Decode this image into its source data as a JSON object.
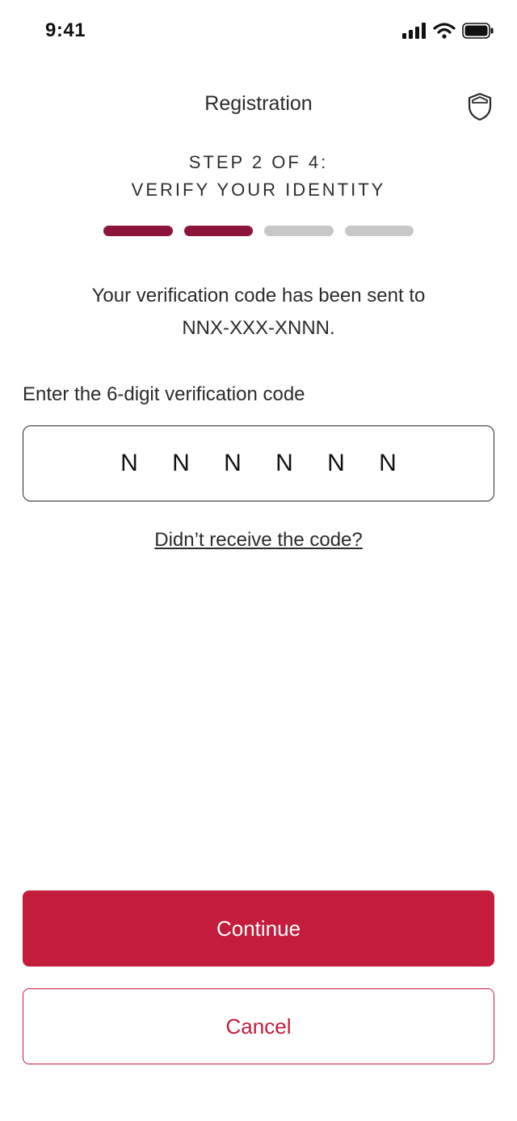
{
  "status_bar": {
    "time": "9:41",
    "icons": [
      "signal-icon",
      "wifi-icon",
      "battery-icon"
    ]
  },
  "header": {
    "title": "Registration",
    "icon": "shield-icon"
  },
  "step": {
    "line1": "STEP 2 OF 4:",
    "line2": "VERIFY YOUR IDENTITY",
    "current": 2,
    "total": 4
  },
  "message": {
    "line1": "Your verification code has been sent to",
    "line2": "NNX-XXX-XNNN."
  },
  "code_field": {
    "label": "Enter the 6-digit verification code",
    "digits": [
      "N",
      "N",
      "N",
      "N",
      "N",
      "N"
    ]
  },
  "resend_link": "Didn’t receive the code?",
  "buttons": {
    "continue": "Continue",
    "cancel": "Cancel"
  },
  "colors": {
    "accent": "#c41c3b",
    "progress_done": "#8c1639",
    "progress_pending": "#c7c7c7"
  }
}
